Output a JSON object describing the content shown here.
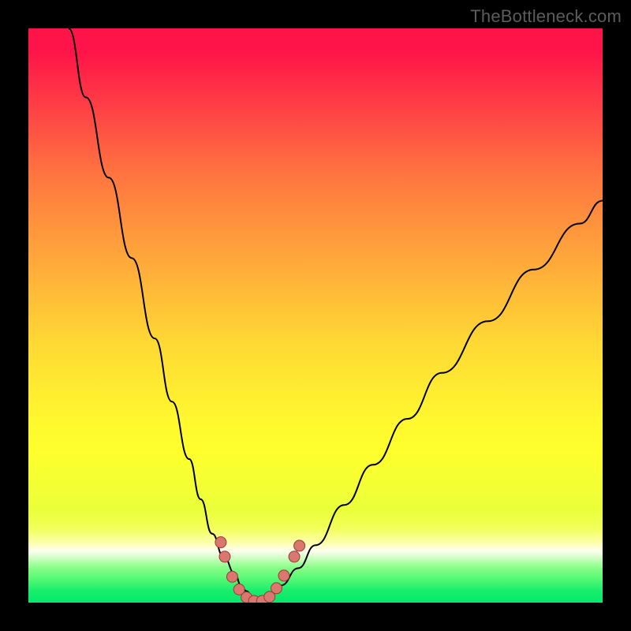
{
  "credit_text": "TheBottleneck.com",
  "colors": {
    "frame": "#000000",
    "curve_stroke": "#000000",
    "beads_fill": "#da776e",
    "beads_stroke": "#9e3a38",
    "gradient_stops": [
      "#fe1448",
      "#fe1448",
      "#fe3846",
      "#ff7340",
      "#ffa73b",
      "#ffd934",
      "#fff72f",
      "#feff2c",
      "#eaff3a",
      "#f3ff59",
      "#fcffa8",
      "#fffef1",
      "#c4ffb8",
      "#86fd86",
      "#51f874",
      "#17ee6c",
      "#03e96c"
    ]
  },
  "chart_data": {
    "type": "line",
    "title": "",
    "xlabel": "",
    "ylabel": "",
    "xlim": [
      0,
      100
    ],
    "ylim": [
      0,
      100
    ],
    "series": [
      {
        "name": "left-branch",
        "x": [
          7,
          10,
          14,
          18,
          22,
          25,
          28,
          30,
          32,
          34,
          36,
          37,
          38,
          39,
          40
        ],
        "y": [
          100,
          88,
          74,
          60,
          46,
          35,
          25,
          18,
          12,
          8,
          5,
          3,
          2,
          1,
          0
        ]
      },
      {
        "name": "right-branch",
        "x": [
          40,
          42,
          44,
          47,
          50,
          55,
          60,
          66,
          72,
          80,
          88,
          96,
          100
        ],
        "y": [
          0,
          1,
          3,
          6,
          10,
          17,
          24,
          32,
          40,
          49,
          58,
          66,
          70
        ]
      }
    ],
    "beads": {
      "name": "bottom-beads",
      "points": [
        {
          "x": 33.5,
          "y": 10.5
        },
        {
          "x": 34.2,
          "y": 8.0
        },
        {
          "x": 35.5,
          "y": 4.5
        },
        {
          "x": 36.7,
          "y": 2.3
        },
        {
          "x": 38.0,
          "y": 0.9
        },
        {
          "x": 39.3,
          "y": 0.3
        },
        {
          "x": 40.7,
          "y": 0.3
        },
        {
          "x": 42.0,
          "y": 1.0
        },
        {
          "x": 43.2,
          "y": 2.5
        },
        {
          "x": 44.5,
          "y": 4.7
        },
        {
          "x": 46.3,
          "y": 8.0
        },
        {
          "x": 47.2,
          "y": 9.9
        }
      ],
      "radius_px": 7
    }
  }
}
